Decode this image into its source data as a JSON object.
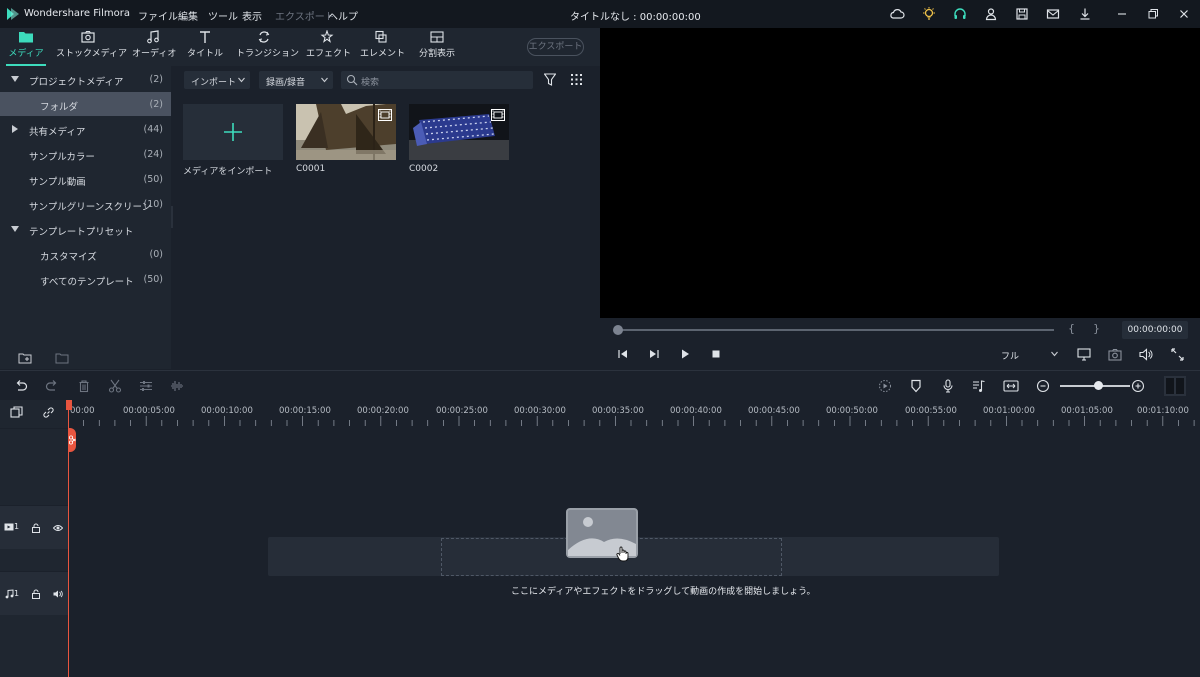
{
  "app": {
    "name": "Wondershare Filmora",
    "window_title": "タイトルなし : 00:00:00:00",
    "menu": [
      "ファイル",
      "編集",
      "ツール",
      "表示",
      "エクスポート",
      "ヘルプ"
    ]
  },
  "toolbar": {
    "tabs": [
      "メディア",
      "ストックメディア",
      "オーディオ",
      "タイトル",
      "トランジション",
      "エフェクト",
      "エレメント",
      "分割表示"
    ],
    "export_label": "エクスポート"
  },
  "library": {
    "items": [
      {
        "label": "プロジェクトメディア",
        "count": "(2)"
      },
      {
        "label": "フォルダ",
        "count": "(2)"
      },
      {
        "label": "共有メディア",
        "count": "(44)"
      },
      {
        "label": "サンプルカラー",
        "count": "(24)"
      },
      {
        "label": "サンプル動画",
        "count": "(50)"
      },
      {
        "label": "サンプルグリーンスクリーン",
        "count": "(10)"
      },
      {
        "label": "テンプレートプリセット",
        "count": ""
      },
      {
        "label": "カスタマイズ",
        "count": "(0)"
      },
      {
        "label": "すべてのテンプレート",
        "count": "(50)"
      }
    ]
  },
  "media": {
    "import_label": "インポート",
    "record_label": "録画/録音",
    "search_placeholder": "検索",
    "import_tile_label": "メディアをインポート",
    "clips": [
      "C0001",
      "C0002"
    ]
  },
  "preview": {
    "timecode": "00:00:00:00",
    "zoom": "フル",
    "brackets_in": "{",
    "brackets_out": "}"
  },
  "timeline": {
    "ticks": [
      "00:00",
      "00:00:05:00",
      "00:00:10:00",
      "00:00:15:00",
      "00:00:20:00",
      "00:00:25:00",
      "00:00:30:00",
      "00:00:35:00",
      "00:00:40:00",
      "00:00:45:00",
      "00:00:50:00",
      "00:00:55:00",
      "00:01:00:00",
      "00:01:05:00",
      "00:01:10:00"
    ],
    "video_track_label": "1",
    "audio_track_label": "1",
    "drop_message": "ここにメディアやエフェクトをドラッグして動画の作成を開始しましょう。"
  },
  "colors": {
    "accent": "#3ddcbd",
    "playhead": "#e8553f"
  }
}
